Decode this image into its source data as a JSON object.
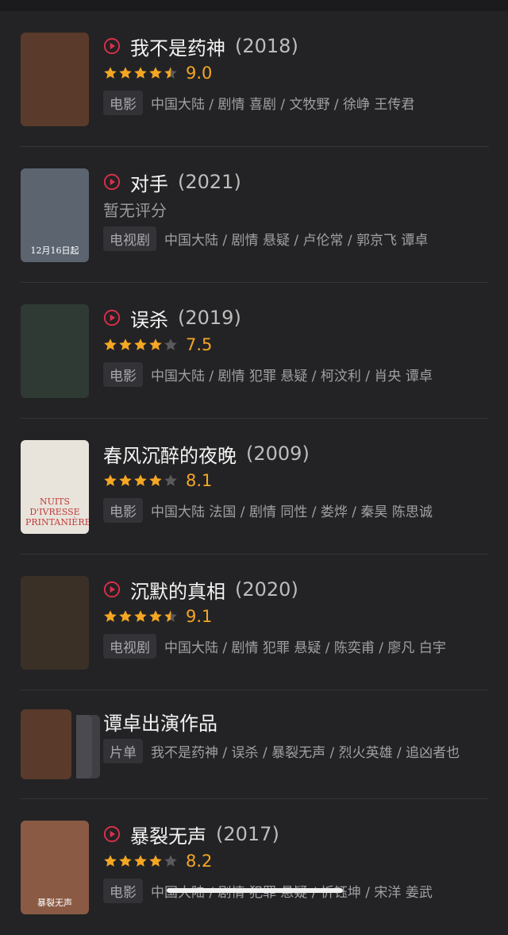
{
  "items": [
    {
      "title": "我不是药神",
      "year": "(2018)",
      "has_play": true,
      "rating": 4.5,
      "score": "9.0",
      "no_rating": "",
      "tag": "电影",
      "meta": "中国大陆 / 剧情 喜剧 / 文牧野 / 徐峥 王传君",
      "poster_color": "#5a3a2a",
      "poster_caption": ""
    },
    {
      "title": "对手",
      "year": "(2021)",
      "has_play": true,
      "rating": null,
      "score": "",
      "no_rating": "暂无评分",
      "tag": "电视剧",
      "meta": "中国大陆 / 剧情 悬疑 / 卢伦常 / 郭京飞 谭卓",
      "poster_color": "#5c6470",
      "poster_caption": "12月16日起"
    },
    {
      "title": "误杀",
      "year": "(2019)",
      "has_play": true,
      "rating": 4,
      "score": "7.5",
      "no_rating": "",
      "tag": "电影",
      "meta": "中国大陆 / 剧情 犯罪 悬疑 / 柯汶利 / 肖央 谭卓",
      "poster_color": "#2e3a33",
      "poster_caption": ""
    },
    {
      "title": "春风沉醉的夜晚",
      "year": "(2009)",
      "has_play": false,
      "rating": 4,
      "score": "8.1",
      "no_rating": "",
      "tag": "电影",
      "meta": "中国大陆 法国 / 剧情 同性 / 娄烨 / 秦昊 陈思诚",
      "poster_color": "#e8e4dc",
      "poster_caption": "NUITS D'IVRESSE PRINTANIÈRE"
    },
    {
      "title": "沉默的真相",
      "year": "(2020)",
      "has_play": true,
      "rating": 4.5,
      "score": "9.1",
      "no_rating": "",
      "tag": "电视剧",
      "meta": "中国大陆 / 剧情 犯罪 悬疑 / 陈奕甫 / 廖凡 白宇",
      "poster_color": "#3a3026",
      "poster_caption": ""
    },
    {
      "title": "谭卓出演作品",
      "year": "",
      "has_play": false,
      "rating": null,
      "score": "",
      "no_rating": "",
      "tag": "片单",
      "meta": "我不是药神 / 误杀 / 暴裂无声 / 烈火英雄 / 追凶者也",
      "poster_color": "#5a3a2a",
      "poster_caption": ""
    },
    {
      "title": "暴裂无声",
      "year": "(2017)",
      "has_play": true,
      "rating": 4,
      "score": "8.2",
      "no_rating": "",
      "tag": "电影",
      "meta": "中国大陆 / 剧情 犯罪 悬疑 / 忻钰坤 / 宋洋 姜武",
      "poster_color": "#8a5a44",
      "poster_caption": "暴裂无声"
    }
  ],
  "colors": {
    "accent": "#e0304a",
    "star": "#f5a623",
    "star_empty": "#5a5a5e"
  }
}
